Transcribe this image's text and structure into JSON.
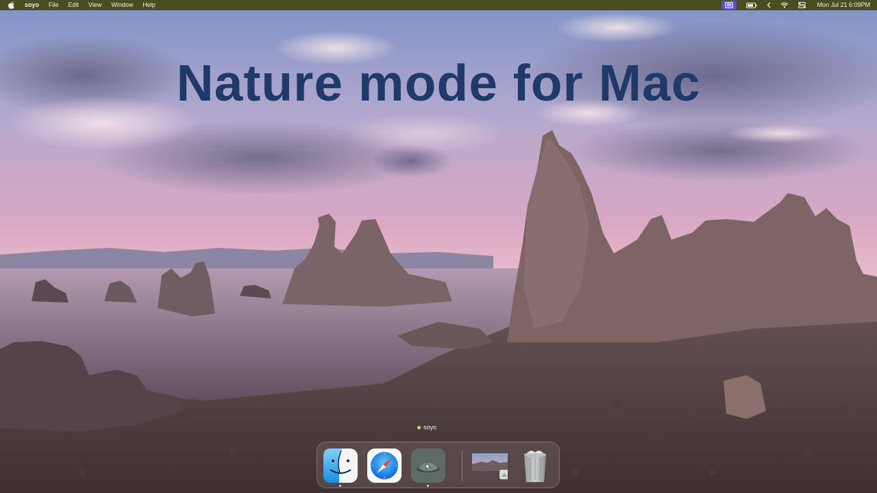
{
  "menubar": {
    "apple_icon": "apple-logo",
    "app_name": "soyo",
    "menus": [
      "File",
      "Edit",
      "View",
      "Window",
      "Help"
    ],
    "status_icons": [
      "screen-mirroring-icon",
      "battery-icon",
      "chevron-left-icon",
      "wifi-icon",
      "control-center-icon"
    ],
    "datetime": "Mon Jul 21  6:09PM"
  },
  "wallpaper": {
    "title": "Nature mode for Mac"
  },
  "dock": {
    "tooltip": "soyo",
    "items": [
      "Finder",
      "Safari",
      "soyo",
      "Photo",
      "Trash"
    ],
    "colors": {
      "menubar": "#4a4d1f",
      "title": "#1f3a6a",
      "tooltip_dot": "#e6d447"
    }
  }
}
